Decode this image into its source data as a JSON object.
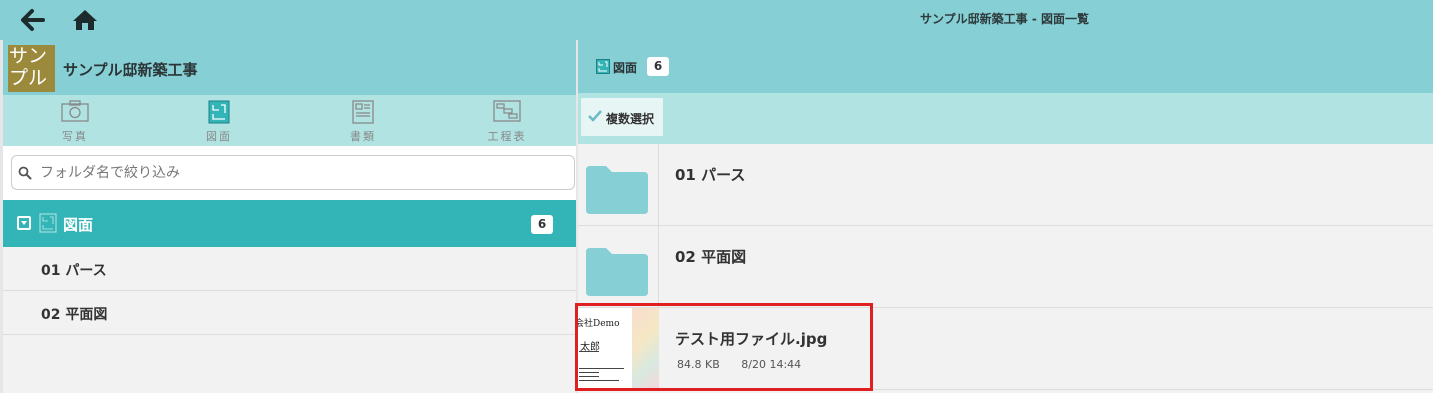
{
  "topbar": {
    "back_icon": "arrow-left-icon",
    "home_icon": "home-icon",
    "title": "サンプル邸新築工事 - 図面一覧"
  },
  "project": {
    "thumb_text": "サンプル",
    "name": "サンプル邸新築工事"
  },
  "categories": [
    {
      "icon": "camera-icon",
      "label": "写真"
    },
    {
      "icon": "drawing-icon",
      "label": "図面",
      "active": true
    },
    {
      "icon": "document-icon",
      "label": "書類"
    },
    {
      "icon": "schedule-icon",
      "label": "工程表"
    }
  ],
  "search": {
    "placeholder": "フォルダ名で絞り込み",
    "value": ""
  },
  "tree": {
    "root": {
      "label": "図面",
      "count": "6"
    },
    "items": [
      {
        "label": "01 パース"
      },
      {
        "label": "02 平面図"
      }
    ]
  },
  "right": {
    "header": {
      "label": "図面",
      "count": "6"
    },
    "multi_select_label": "複数選択",
    "rows": [
      {
        "type": "folder",
        "name": "01 パース"
      },
      {
        "type": "folder",
        "name": "02 平面図"
      },
      {
        "type": "file",
        "name": "テスト用ファイル.jpg",
        "size": "84.8 KB",
        "date": "8/20 14:44",
        "thumb_line1": "会社Demo",
        "thumb_line2": "太郎"
      }
    ]
  },
  "colors": {
    "header_teal": "#86cfd5",
    "light_teal": "#b0e3e2",
    "selected_teal": "#33b5b8",
    "highlight_red": "#e02020"
  }
}
